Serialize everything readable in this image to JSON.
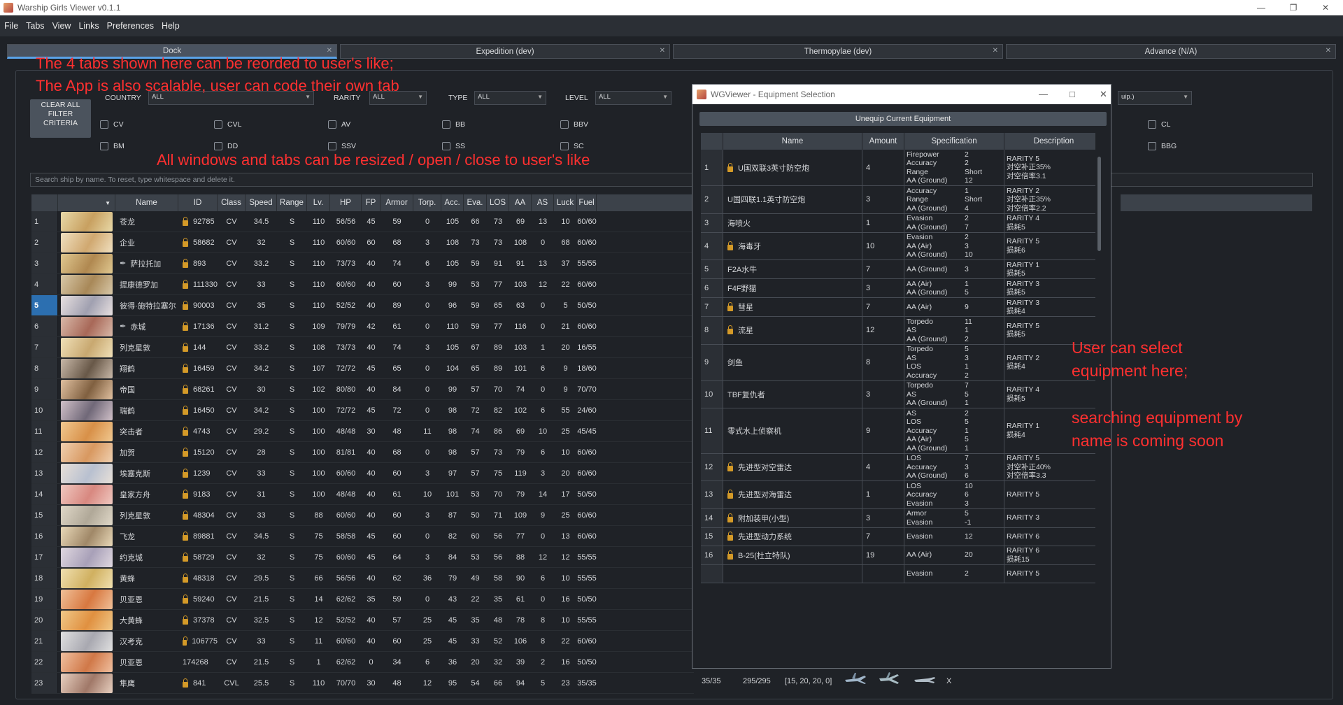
{
  "window": {
    "title": "Warship Girls Viewer v0.1.1"
  },
  "menu": [
    "File",
    "Tabs",
    "View",
    "Links",
    "Preferences",
    "Help"
  ],
  "tabs": [
    {
      "label": "Dock",
      "active": true
    },
    {
      "label": "Expedition (dev)",
      "active": false
    },
    {
      "label": "Thermopylae (dev)",
      "active": false
    },
    {
      "label": "Advance (N/A)",
      "active": false
    }
  ],
  "annotations": {
    "line1": "The 4 tabs shown here can be reorded to user's like;",
    "line2": "The App is also scalable, user can code their own tab",
    "line3": "All windows and tabs can be resized / open / close to user's like",
    "line4": "User can select",
    "line5": "equipment here;",
    "line6": "searching equipment by",
    "line7": "name is coming soon",
    "color": "#ff3030"
  },
  "filters": {
    "clear_label": "CLEAR ALL FILTER CRITERIA",
    "country_label": "COUNTRY",
    "country_value": "ALL",
    "rarity_label": "RARITY",
    "rarity_value": "ALL",
    "type_label": "TYPE",
    "type_value": "ALL",
    "level_label": "LEVEL",
    "level_value": "ALL",
    "equip_value": "uip.)",
    "checks": {
      "cv": "CV",
      "cvl": "CVL",
      "av": "AV",
      "bb": "BB",
      "bbv": "BBV",
      "cl": "CL",
      "bm": "BM",
      "dd": "DD",
      "ssv": "SSV",
      "ss": "SS",
      "sc": "SC",
      "bbg": "BBG"
    }
  },
  "search": {
    "placeholder": "Search ship by name. To reset, type whitespace and delete it."
  },
  "grid": {
    "headers": [
      "",
      "Name",
      "ID",
      "Class",
      "Speed",
      "Range",
      "Lv.",
      "HP",
      "FP",
      "Armor",
      "Torp.",
      "Acc.",
      "Eva.",
      "LOS",
      "AA",
      "AS",
      "Luck",
      "Fuel"
    ],
    "selected_row": 5,
    "rows": [
      [
        "1",
        "苍龙",
        "92785",
        "CV",
        "34.5",
        "S",
        "110",
        "56/56",
        "45",
        "59",
        "0",
        "105",
        "66",
        "73",
        "69",
        "13",
        "10",
        "60/60"
      ],
      [
        "2",
        "企业",
        "58682",
        "CV",
        "32",
        "S",
        "110",
        "60/60",
        "60",
        "68",
        "3",
        "108",
        "73",
        "73",
        "108",
        "0",
        "68",
        "60/60"
      ],
      [
        "3",
        "萨拉托加",
        "893",
        "CV",
        "33.2",
        "S",
        "110",
        "73/73",
        "40",
        "74",
        "6",
        "105",
        "59",
        "91",
        "91",
        "13",
        "37",
        "55/55"
      ],
      [
        "4",
        "提康德罗加",
        "111330",
        "CV",
        "33",
        "S",
        "110",
        "60/60",
        "40",
        "60",
        "3",
        "99",
        "53",
        "77",
        "103",
        "12",
        "22",
        "60/60"
      ],
      [
        "5",
        "彼得·施特拉塞尔",
        "90003",
        "CV",
        "35",
        "S",
        "110",
        "52/52",
        "40",
        "89",
        "0",
        "96",
        "59",
        "65",
        "63",
        "0",
        "5",
        "50/50"
      ],
      [
        "6",
        "赤城",
        "17136",
        "CV",
        "31.2",
        "S",
        "109",
        "79/79",
        "42",
        "61",
        "0",
        "110",
        "59",
        "77",
        "116",
        "0",
        "21",
        "60/60"
      ],
      [
        "7",
        "列克星敦",
        "144",
        "CV",
        "33.2",
        "S",
        "108",
        "73/73",
        "40",
        "74",
        "3",
        "105",
        "67",
        "89",
        "103",
        "1",
        "20",
        "16/55"
      ],
      [
        "8",
        "翔鹤",
        "16459",
        "CV",
        "34.2",
        "S",
        "107",
        "72/72",
        "45",
        "65",
        "0",
        "104",
        "65",
        "89",
        "101",
        "6",
        "9",
        "18/60"
      ],
      [
        "9",
        "帝国",
        "68261",
        "CV",
        "30",
        "S",
        "102",
        "80/80",
        "40",
        "84",
        "0",
        "99",
        "57",
        "70",
        "74",
        "0",
        "9",
        "70/70"
      ],
      [
        "10",
        "瑞鹤",
        "16450",
        "CV",
        "34.2",
        "S",
        "100",
        "72/72",
        "45",
        "72",
        "0",
        "98",
        "72",
        "82",
        "102",
        "6",
        "55",
        "24/60"
      ],
      [
        "11",
        "突击者",
        "4743",
        "CV",
        "29.2",
        "S",
        "100",
        "48/48",
        "30",
        "48",
        "11",
        "98",
        "74",
        "86",
        "69",
        "10",
        "25",
        "45/45"
      ],
      [
        "12",
        "加贺",
        "15120",
        "CV",
        "28",
        "S",
        "100",
        "81/81",
        "40",
        "68",
        "0",
        "98",
        "57",
        "73",
        "79",
        "6",
        "10",
        "60/60"
      ],
      [
        "13",
        "埃塞克斯",
        "1239",
        "CV",
        "33",
        "S",
        "100",
        "60/60",
        "40",
        "60",
        "3",
        "97",
        "57",
        "75",
        "119",
        "3",
        "20",
        "60/60"
      ],
      [
        "14",
        "皇家方舟",
        "9183",
        "CV",
        "31",
        "S",
        "100",
        "48/48",
        "40",
        "61",
        "10",
        "101",
        "53",
        "70",
        "79",
        "14",
        "17",
        "50/50"
      ],
      [
        "15",
        "列克星敦",
        "48304",
        "CV",
        "33",
        "S",
        "88",
        "60/60",
        "40",
        "60",
        "3",
        "87",
        "50",
        "71",
        "109",
        "9",
        "25",
        "60/60"
      ],
      [
        "16",
        "飞龙",
        "89881",
        "CV",
        "34.5",
        "S",
        "75",
        "58/58",
        "45",
        "60",
        "0",
        "82",
        "60",
        "56",
        "77",
        "0",
        "13",
        "60/60"
      ],
      [
        "17",
        "约克城",
        "58729",
        "CV",
        "32",
        "S",
        "75",
        "60/60",
        "45",
        "64",
        "3",
        "84",
        "53",
        "56",
        "88",
        "12",
        "12",
        "55/55"
      ],
      [
        "18",
        "黄蜂",
        "48318",
        "CV",
        "29.5",
        "S",
        "66",
        "56/56",
        "40",
        "62",
        "36",
        "79",
        "49",
        "58",
        "90",
        "6",
        "10",
        "55/55"
      ],
      [
        "19",
        "贝亚恩",
        "59240",
        "CV",
        "21.5",
        "S",
        "14",
        "62/62",
        "35",
        "59",
        "0",
        "43",
        "22",
        "35",
        "61",
        "0",
        "16",
        "50/50"
      ],
      [
        "20",
        "大黄蜂",
        "37378",
        "CV",
        "32.5",
        "S",
        "12",
        "52/52",
        "40",
        "57",
        "25",
        "45",
        "35",
        "48",
        "78",
        "8",
        "10",
        "55/55"
      ],
      [
        "21",
        "汉考克",
        "106775",
        "CV",
        "33",
        "S",
        "11",
        "60/60",
        "40",
        "60",
        "25",
        "45",
        "33",
        "52",
        "106",
        "8",
        "22",
        "60/60"
      ],
      [
        "22",
        "贝亚恩",
        "174268",
        "CV",
        "21.5",
        "S",
        "1",
        "62/62",
        "0",
        "34",
        "6",
        "36",
        "20",
        "32",
        "39",
        "2",
        "16",
        "50/50"
      ],
      [
        "23",
        "隼鹰",
        "841",
        "CVL",
        "25.5",
        "S",
        "110",
        "70/70",
        "30",
        "48",
        "12",
        "95",
        "54",
        "66",
        "94",
        "5",
        "23",
        "35/35"
      ]
    ],
    "locked": [
      true,
      true,
      true,
      true,
      true,
      true,
      true,
      true,
      true,
      true,
      true,
      true,
      true,
      true,
      true,
      true,
      true,
      true,
      true,
      true,
      true,
      false,
      true
    ],
    "pinned": [
      false,
      false,
      true,
      false,
      false,
      true,
      false,
      false,
      false,
      false,
      false,
      false,
      false,
      false,
      false,
      false,
      false,
      false,
      false,
      false,
      false,
      false,
      false
    ],
    "row23_extra": {
      "ammo": "35/35",
      "hp_extra": "295/295",
      "slots": "[15, 20, 20, 0]",
      "close": "X"
    }
  },
  "equipment_window": {
    "title": "WGViewer - Equipment Selection",
    "unequip_label": "Unequip Current Equipment",
    "headers": [
      "",
      "Name",
      "Amount",
      "Specification",
      "Description"
    ],
    "rows": [
      {
        "n": "1",
        "name": "U国双联3英寸防空炮",
        "locked": true,
        "amount": "4",
        "spec": [
          [
            "Firepower",
            "2"
          ],
          [
            "Accuracy",
            "2"
          ],
          [
            "Range",
            "Short"
          ],
          [
            "AA (Ground)",
            "12"
          ]
        ],
        "desc": [
          "RARITY 5",
          "对空补正35%",
          "对空倍率3.1"
        ]
      },
      {
        "n": "2",
        "name": "U国四联1.1英寸防空炮",
        "locked": false,
        "amount": "3",
        "spec": [
          [
            "Accuracy",
            "1"
          ],
          [
            "Range",
            "Short"
          ],
          [
            "AA (Ground)",
            "4"
          ]
        ],
        "desc": [
          "RARITY 2",
          "对空补正35%",
          "对空倍率2.2"
        ]
      },
      {
        "n": "3",
        "name": "海喷火",
        "locked": false,
        "amount": "1",
        "spec": [
          [
            "Evasion",
            "2"
          ],
          [
            "AA (Ground)",
            "7"
          ]
        ],
        "desc": [
          "RARITY 4",
          "损耗5"
        ]
      },
      {
        "n": "4",
        "name": "海毒牙",
        "locked": true,
        "amount": "10",
        "spec": [
          [
            "Evasion",
            "2"
          ],
          [
            "AA (Air)",
            "3"
          ],
          [
            "AA (Ground)",
            "10"
          ]
        ],
        "desc": [
          "RARITY 5",
          "损耗6"
        ]
      },
      {
        "n": "5",
        "name": "F2A水牛",
        "locked": false,
        "amount": "7",
        "spec": [
          [
            "AA (Ground)",
            "3"
          ]
        ],
        "desc": [
          "RARITY 1",
          "损耗5"
        ]
      },
      {
        "n": "6",
        "name": "F4F野猫",
        "locked": false,
        "amount": "3",
        "spec": [
          [
            "AA (Air)",
            "1"
          ],
          [
            "AA (Ground)",
            "5"
          ]
        ],
        "desc": [
          "RARITY 3",
          "损耗5"
        ]
      },
      {
        "n": "7",
        "name": "彗星",
        "locked": true,
        "amount": "7",
        "spec": [
          [
            "AA (Air)",
            "9"
          ]
        ],
        "desc": [
          "RARITY 3",
          "损耗4"
        ]
      },
      {
        "n": "8",
        "name": "流星",
        "locked": true,
        "amount": "12",
        "spec": [
          [
            "Torpedo",
            "11"
          ],
          [
            "AS",
            "1"
          ],
          [
            "AA (Ground)",
            "2"
          ]
        ],
        "desc": [
          "RARITY 5",
          "损耗5"
        ]
      },
      {
        "n": "9",
        "name": "剑鱼",
        "locked": false,
        "amount": "8",
        "spec": [
          [
            "Torpedo",
            "5"
          ],
          [
            "AS",
            "3"
          ],
          [
            "LOS",
            "1"
          ],
          [
            "Accuracy",
            "2"
          ]
        ],
        "desc": [
          "RARITY 2",
          "损耗4"
        ]
      },
      {
        "n": "10",
        "name": "TBF复仇者",
        "locked": false,
        "amount": "3",
        "spec": [
          [
            "Torpedo",
            "7"
          ],
          [
            "AS",
            "5"
          ],
          [
            "AA (Ground)",
            "1"
          ]
        ],
        "desc": [
          "RARITY 4",
          "损耗5"
        ]
      },
      {
        "n": "11",
        "name": "零式水上侦察机",
        "locked": false,
        "amount": "9",
        "spec": [
          [
            "AS",
            "2"
          ],
          [
            "LOS",
            "5"
          ],
          [
            "Accuracy",
            "1"
          ],
          [
            "AA (Air)",
            "5"
          ],
          [
            "AA (Ground)",
            "1"
          ]
        ],
        "desc": [
          "RARITY 1",
          "损耗4"
        ]
      },
      {
        "n": "12",
        "name": "先进型对空雷达",
        "locked": true,
        "amount": "4",
        "spec": [
          [
            "LOS",
            "7"
          ],
          [
            "Accuracy",
            "3"
          ],
          [
            "AA (Ground)",
            "6"
          ]
        ],
        "desc": [
          "RARITY 5",
          "对空补正40%",
          "对空倍率3.3"
        ]
      },
      {
        "n": "13",
        "name": "先进型对海雷达",
        "locked": true,
        "amount": "1",
        "spec": [
          [
            "LOS",
            "10"
          ],
          [
            "Accuracy",
            "6"
          ],
          [
            "Evasion",
            "3"
          ]
        ],
        "desc": [
          "RARITY 5"
        ]
      },
      {
        "n": "14",
        "name": "附加装甲(小型)",
        "locked": true,
        "amount": "3",
        "spec": [
          [
            "Armor",
            "5"
          ],
          [
            "Evasion",
            "-1"
          ]
        ],
        "desc": [
          "RARITY 3"
        ]
      },
      {
        "n": "15",
        "name": "先进型动力系统",
        "locked": true,
        "amount": "7",
        "spec": [
          [
            "Evasion",
            "12"
          ]
        ],
        "desc": [
          "RARITY 6"
        ]
      },
      {
        "n": "16",
        "name": "B-25(杜立特队)",
        "locked": true,
        "amount": "19",
        "spec": [
          [
            "AA (Air)",
            "20"
          ]
        ],
        "desc": [
          "RARITY 6",
          "损耗15"
        ]
      },
      {
        "n": "",
        "name": "",
        "locked": false,
        "amount": "",
        "spec": [
          [
            "Evasion",
            "2"
          ]
        ],
        "desc": [
          "RARITY 5"
        ]
      }
    ]
  },
  "colors": {
    "accent": "#5aa3e8",
    "selected_row": "#2c6fb0",
    "lock": "#d49a28",
    "background": "#1f2227"
  }
}
